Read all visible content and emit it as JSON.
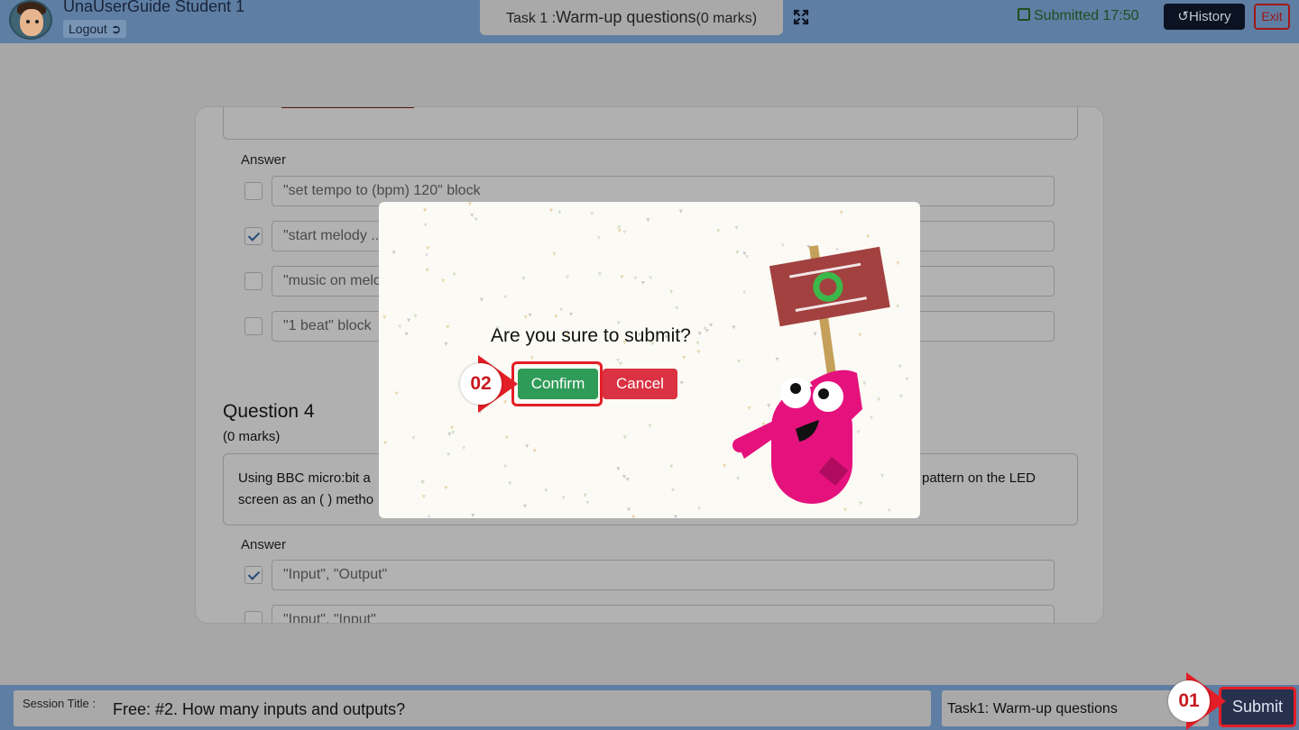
{
  "header": {
    "username": "UnaUserGuide Student 1",
    "logout_label": "Logout",
    "logout_icon": "sign-out-icon",
    "task_prefix": "Task 1 :",
    "task_name": "Warm-up questions",
    "task_marks": "(0 marks)",
    "status": "Submitted 17:50",
    "status_icon": "calendar-check-icon",
    "history_label": "History",
    "history_icon": "history-icon",
    "exit_label": "Exit"
  },
  "question3": {
    "answer_label": "Answer",
    "options": [
      {
        "text": "\"set tempo to (bpm) 120\"  block",
        "checked": false
      },
      {
        "text": "\"start melody ...",
        "checked": true
      },
      {
        "text": "\"music on melo",
        "checked": false
      },
      {
        "text": "\"1 beat\" block",
        "checked": false
      }
    ]
  },
  "question4": {
    "title": "Question 4",
    "marks": "(0 marks)",
    "text_line1_start": "Using BBC micro:bit a",
    "text_line1_end": "pattern on the LED",
    "text_line2": "screen as an ( ) metho",
    "answer_label": "Answer",
    "options": [
      {
        "text": "\"Input\", \"Output\"",
        "checked": true
      },
      {
        "text": "\"Input\", \"Input\"",
        "checked": false
      }
    ]
  },
  "modal": {
    "question": "Are you sure to submit?",
    "confirm_label": "Confirm",
    "cancel_label": "Cancel"
  },
  "footer": {
    "session_label": "Session Title :",
    "session_value": "Free: #2. How many inputs and outputs?",
    "task_select_value": "Task1: Warm-up questions",
    "submit_label": "Submit"
  },
  "markers": {
    "step1": "01",
    "step2": "02"
  },
  "colors": {
    "topbar": "#5f7ea3",
    "confirm": "#2f9b58",
    "cancel": "#da3242",
    "highlight": "#e41e26",
    "history": "#0b1323"
  }
}
